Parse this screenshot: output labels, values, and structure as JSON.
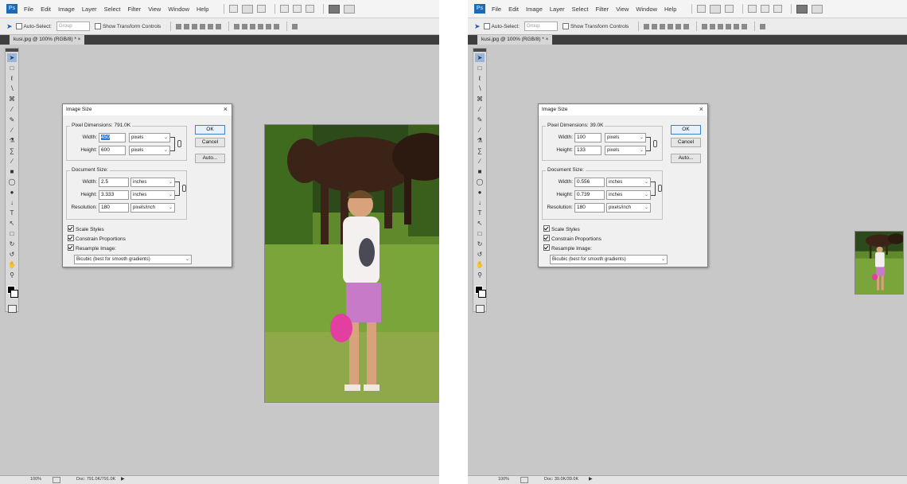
{
  "menu": {
    "logo": "Ps",
    "items": [
      "File",
      "Edit",
      "Image",
      "Layer",
      "Select",
      "Filter",
      "View",
      "Window",
      "Help"
    ]
  },
  "options_bar": {
    "auto_select_label": "Auto-Select:",
    "auto_select_value": "Group",
    "show_transform_label": "Show Transform Controls"
  },
  "panels": [
    {
      "doc_tab": "kusi.jpg @ 100% (RGB/8) * ×",
      "dialog": {
        "title": "Image Size",
        "close": "×",
        "pixel_dimensions_label": "Pixel Dimensions: 791.0K",
        "width_label": "Width:",
        "width_value": "450",
        "width_unit": "pixels",
        "height_label": "Height:",
        "height_value": "600",
        "height_unit": "pixels",
        "document_size_label": "Document Size:",
        "doc_width_label": "Width:",
        "doc_width_value": "2.5",
        "doc_width_unit": "inches",
        "doc_height_label": "Height:",
        "doc_height_value": "3.333",
        "doc_height_unit": "inches",
        "resolution_label": "Resolution:",
        "resolution_value": "180",
        "resolution_unit": "pixels/inch",
        "scale_styles": "Scale Styles",
        "constrain": "Constrain Proportions",
        "resample": "Resample Image:",
        "resample_method": "Bicubic (best for smooth gradients)",
        "ok": "OK",
        "cancel": "Cancel",
        "auto": "Auto..."
      },
      "status": {
        "zoom": "100%",
        "doc": "Doc: 791.0K/791.0K"
      }
    },
    {
      "doc_tab": "kusi.jpg @ 100% (RGB/8) * ×",
      "dialog": {
        "title": "Image Size",
        "close": "×",
        "pixel_dimensions_label": "Pixel Dimensions: 39.0K",
        "width_label": "Width:",
        "width_value": "100",
        "width_unit": "pixels",
        "height_label": "Height:",
        "height_value": "133",
        "height_unit": "pixels",
        "document_size_label": "Document Size:",
        "doc_width_label": "Width:",
        "doc_width_value": "0.556",
        "doc_width_unit": "inches",
        "doc_height_label": "Height:",
        "doc_height_value": "0.739",
        "doc_height_unit": "inches",
        "resolution_label": "Resolution:",
        "resolution_value": "180",
        "resolution_unit": "pixels/inch",
        "scale_styles": "Scale Styles",
        "constrain": "Constrain Proportions",
        "resample": "Resample Image:",
        "resample_method": "Bicubic (best for smooth gradients)",
        "ok": "OK",
        "cancel": "Cancel",
        "auto": "Auto..."
      },
      "status": {
        "zoom": "100%",
        "doc": "Doc: 39.0K/39.0K"
      }
    }
  ],
  "colors": {
    "workspace": "#c8c8c8",
    "accent": "#3179d6",
    "logo": "#1e68b8"
  }
}
